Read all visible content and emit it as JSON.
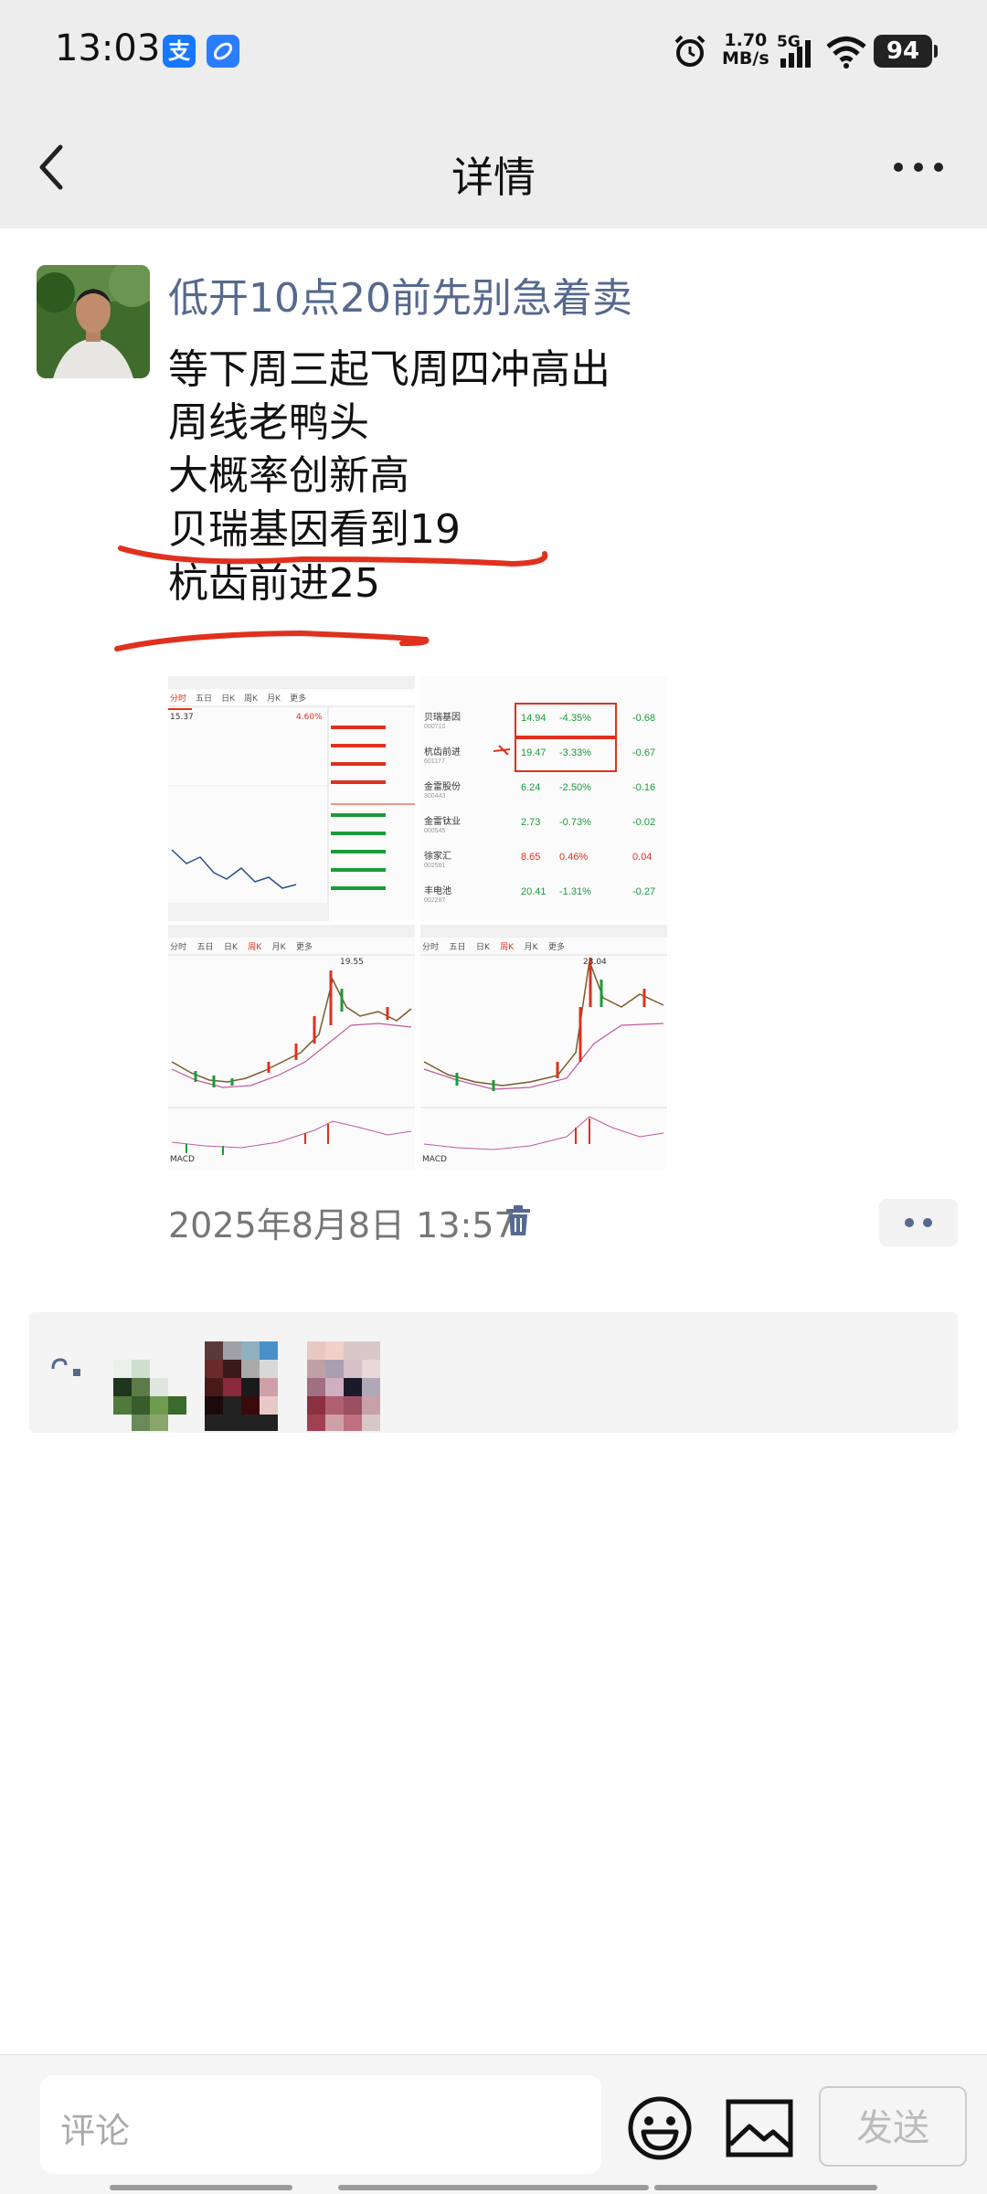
{
  "status_bar": {
    "time": "13:03",
    "alipay_glyph": "支",
    "net_speed_value": "1.70",
    "net_speed_unit": "MB/s",
    "network": "5G",
    "battery": "94",
    "icons": [
      "alipay-icon",
      "app-icon",
      "alarm-icon",
      "signal-icon",
      "wifi-icon",
      "battery-icon"
    ]
  },
  "header": {
    "title": "详情"
  },
  "post": {
    "username": "低开10点20前先别急着卖",
    "lines": [
      "等下周三起飞周四冲高出",
      "周线老鸭头",
      "大概率创新高",
      "贝瑞基因看到19",
      "杭齿前进25"
    ],
    "annotation_color": "#e0301e",
    "timestamp": "2025年8月8日 13:57",
    "photos": [
      {
        "tabs": [
          "分时",
          "五日",
          "日K",
          "周K",
          "月K",
          "更多"
        ],
        "price_top": "15.37",
        "tag": "4.60%"
      },
      {
        "rows": [
          {
            "name": "贝瑞基因",
            "code": "000710",
            "price": "14.94",
            "change": "-4.35%",
            "extra": "-0.68"
          },
          {
            "name": "杭齿前进",
            "code": "601177",
            "price": "19.47",
            "change": "-3.33%",
            "extra": "-0.67"
          },
          {
            "name": "金雷股份",
            "code": "300443",
            "price": "6.24",
            "change": "-2.50%",
            "extra": "-0.16"
          },
          {
            "name": "金雷钛业",
            "code": "000545",
            "price": "2.73",
            "change": "-0.73%",
            "extra": "-0.02"
          },
          {
            "name": "徐家汇",
            "code": "002561",
            "price": "8.65",
            "change": "0.46%",
            "extra": "0.04"
          },
          {
            "name": "丰电池",
            "code": "002287",
            "price": "20.41",
            "change": "-1.31%",
            "extra": "-0.27"
          }
        ]
      },
      {
        "tabs": [
          "分时",
          "五日",
          "日K",
          "周K",
          "月K",
          "更多"
        ],
        "high_label": "19.55",
        "indicator": "MACD"
      },
      {
        "tabs": [
          "分时",
          "五日",
          "日K",
          "周K",
          "月K",
          "更多"
        ],
        "high_label": "23.04",
        "indicator": "MACD"
      }
    ]
  },
  "comment_bar": {
    "placeholder": "评论",
    "send_label": "发送"
  },
  "colors": {
    "link_blue": "#56698e",
    "header_bg": "#ededed",
    "up_red": "#e0301e",
    "down_green": "#1a9b3a"
  }
}
